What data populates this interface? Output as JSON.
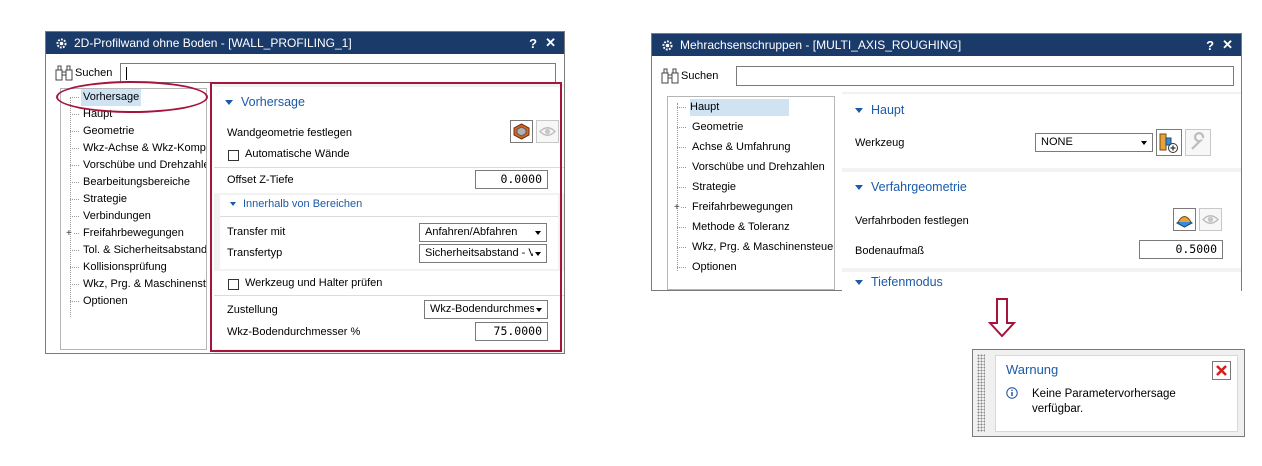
{
  "dialog1": {
    "title": "2D-Profilwand ohne Boden - [WALL_PROFILING_1]",
    "help": "?",
    "close": "✕",
    "search_label": "Suchen",
    "search_value": "",
    "tree": [
      "Vorhersage",
      "Haupt",
      "Geometrie",
      "Wkz-Achse & Wkz-Komp.",
      "Vorschübe und Drehzahlen",
      "Bearbeitungsbereiche",
      "Strategie",
      "Verbindungen",
      "Freifahrbewegungen",
      "Tol. & Sicherheitsabstand",
      "Kollisionsprüfung",
      "Wkz, Prg. & Maschinensteuerung",
      "Optionen"
    ],
    "section_title": "Vorhersage",
    "wall_geometry_label": "Wandgeometrie festlegen",
    "auto_walls_label": "Automatische Wände",
    "offset_label": "Offset Z-Tiefe",
    "offset_value": "0.0000",
    "subsection_title": "Innerhalb von Bereichen",
    "transfer_label": "Transfer mit",
    "transfer_value": "Anfahren/Abfahren",
    "transfertype_label": "Transfertyp",
    "transfertype_value": "Sicherheitsabstand - V",
    "check_tool_label": "Werkzeug und Halter prüfen",
    "feed_label": "Zustellung",
    "feed_value": "Wkz-Bodendurchmesser",
    "diameter_label": "Wkz-Bodendurchmesser %",
    "diameter_value": "75.0000"
  },
  "dialog2": {
    "title": "Mehrachsenschruppen - [MULTI_AXIS_ROUGHING]",
    "help": "?",
    "close": "✕",
    "search_label": "Suchen",
    "search_value": "",
    "tree": [
      "Haupt",
      "Geometrie",
      "Achse & Umfahrung",
      "Vorschübe und Drehzahlen",
      "Strategie",
      "Freifahrbewegungen",
      "Methode & Toleranz",
      "Wkz, Prg. & Maschinensteuerung",
      "Optionen"
    ],
    "section1_title": "Haupt",
    "tool_label": "Werkzeug",
    "tool_value": "NONE",
    "section2_title": "Verfahrgeometrie",
    "floor_label": "Verfahrboden festlegen",
    "floor_allowance_label": "Bodenaufmaß",
    "floor_allowance_value": "0.5000",
    "section3_title": "Tiefenmodus"
  },
  "warning": {
    "title": "Warnung",
    "message": "Keine Parametervorhersage verfügbar."
  },
  "colors": {
    "titlebar": "#1a3a6a",
    "highlight": "#a5143d",
    "section_title": "#1a5aa8",
    "selection": "#cfe3f3"
  }
}
